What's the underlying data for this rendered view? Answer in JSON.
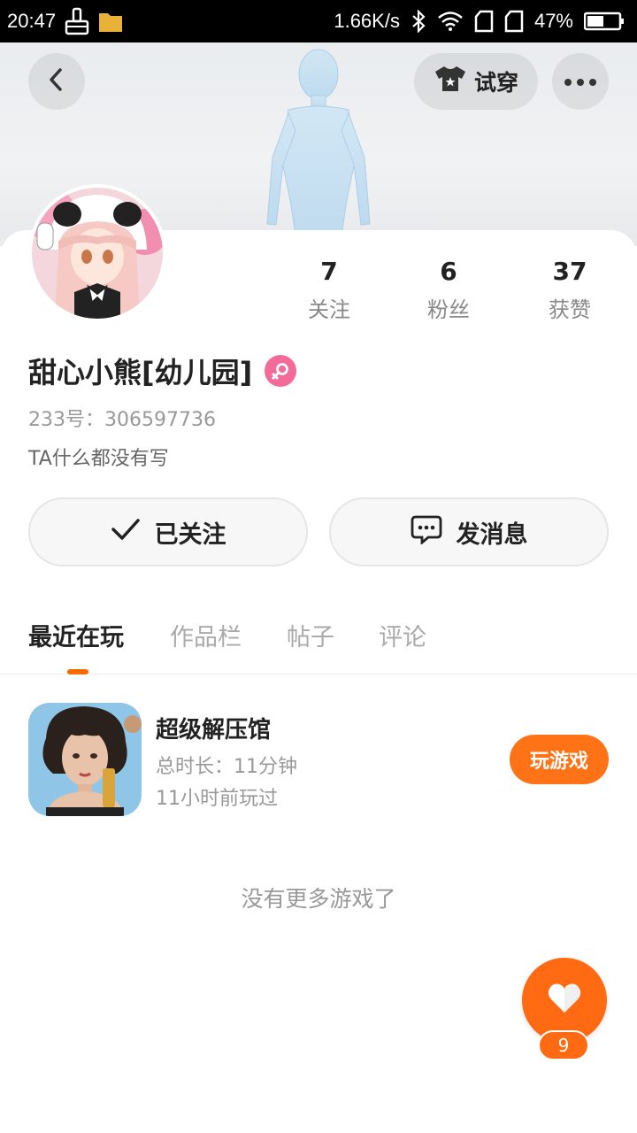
{
  "status_bar": {
    "time": "20:47",
    "network_speed": "1.66K/s",
    "battery": "47%",
    "icons": [
      "cleaner-icon",
      "folder-icon",
      "bluetooth-icon",
      "wifi-icon",
      "signal-icon",
      "signal-icon",
      "battery-icon"
    ]
  },
  "header": {
    "try_on_label": "试穿",
    "icons": {
      "back": "back-arrow-icon",
      "try_on": "tshirt-icon",
      "more": "more-dots-icon"
    }
  },
  "profile": {
    "nickname": "甜心小熊[幼儿园]",
    "gender_icon": "female-icon",
    "uid": "233号：306597736",
    "bio": "TA什么都没有写"
  },
  "stats": [
    {
      "value": "7",
      "label": "关注"
    },
    {
      "value": "6",
      "label": "粉丝"
    },
    {
      "value": "37",
      "label": "获赞"
    }
  ],
  "actions": {
    "follow_label": "已关注",
    "message_label": "发消息"
  },
  "tabs": [
    {
      "label": "最近在玩",
      "active": true
    },
    {
      "label": "作品栏",
      "active": false
    },
    {
      "label": "帖子",
      "active": false
    },
    {
      "label": "评论",
      "active": false
    }
  ],
  "games": [
    {
      "name": "超级解压馆",
      "duration": "总时长：11分钟",
      "last_played": "11小时前玩过",
      "play_label": "玩游戏"
    }
  ],
  "no_more_text": "没有更多游戏了",
  "fab": {
    "icon": "heart-icon",
    "count": "9"
  },
  "colors": {
    "accent": "#ff6a12",
    "gender_badge": "#f46a98"
  }
}
